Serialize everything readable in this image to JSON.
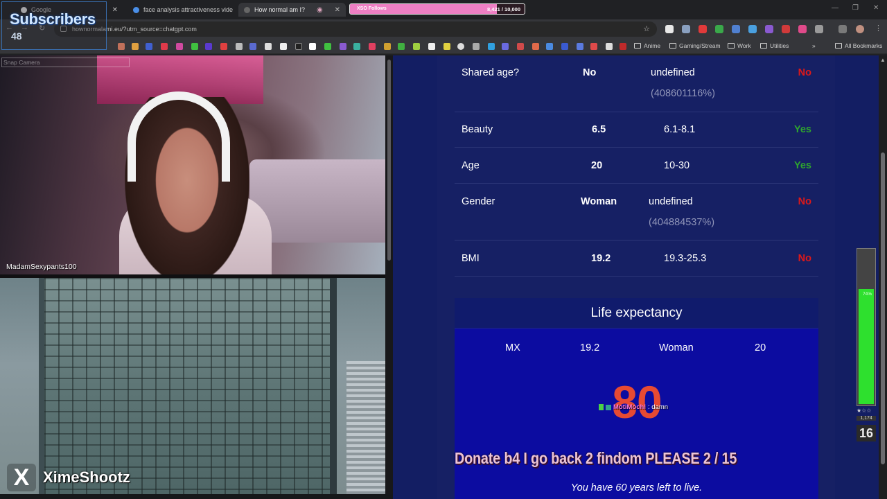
{
  "browser": {
    "tabs": [
      {
        "label": "Google",
        "active": false
      },
      {
        "label": "face analysis attractiveness vide",
        "active": false
      },
      {
        "label": "How normal am I?",
        "active": true
      }
    ],
    "url": "hownormalami.eu/?utm_source=chatgpt.com",
    "bookmarks": [
      "Anime",
      "Gaming/Stream",
      "Work",
      "Utilities",
      "All Bookmarks"
    ],
    "icons": [
      "back-icon",
      "forward-icon",
      "reload-icon",
      "lock-icon",
      "star-icon",
      "extensions-icon",
      "profile-icon",
      "menu-icon"
    ]
  },
  "overlay": {
    "subscribers": {
      "title": "Subscribers",
      "count": "48"
    },
    "follows": {
      "label": "XSO Follows",
      "count": "8,421 / 10,000",
      "progress": 0.8421,
      "color": "#ee7fc4"
    },
    "snap_camera": "Snap Camera",
    "cam_name": "MadamSexypants100",
    "x_logo": "X",
    "x_name": "XimeShootz",
    "chat": {
      "user": "MotiMochi",
      "message": " : damn"
    },
    "donate": "Donate b4 I go back 2 findom PLEASE  2 / 15",
    "meter": {
      "percent_label": "74%",
      "level": 0.74,
      "stars": "★☆☆",
      "count": "1,174",
      "number": "16",
      "color": "#2ee02e"
    }
  },
  "results": {
    "rows": [
      {
        "label": "Shared age?",
        "value": "No",
        "range": "undefined",
        "range_sub": "(408601116%)",
        "verdict": "No",
        "verdict_type": "no"
      },
      {
        "label": "Beauty",
        "value": "6.5",
        "range": "6.1-8.1",
        "range_sub": "",
        "verdict": "Yes",
        "verdict_type": "yes"
      },
      {
        "label": "Age",
        "value": "20",
        "range": "10-30",
        "range_sub": "",
        "verdict": "Yes",
        "verdict_type": "yes"
      },
      {
        "label": "Gender",
        "value": "Woman",
        "range": "undefined",
        "range_sub": "(404884537%)",
        "verdict": "No",
        "verdict_type": "no"
      },
      {
        "label": "BMI",
        "value": "19.2",
        "range": "19.3-25.3",
        "range_sub": "",
        "verdict": "No",
        "verdict_type": "no"
      }
    ],
    "colors": {
      "no": "#e01818",
      "yes": "#2ea52e"
    }
  },
  "life_expectancy": {
    "title": "Life expectancy",
    "inputs": [
      "MX",
      "19.2",
      "Woman",
      "20"
    ],
    "years": "80",
    "remaining": "You have 60 years left to live."
  }
}
